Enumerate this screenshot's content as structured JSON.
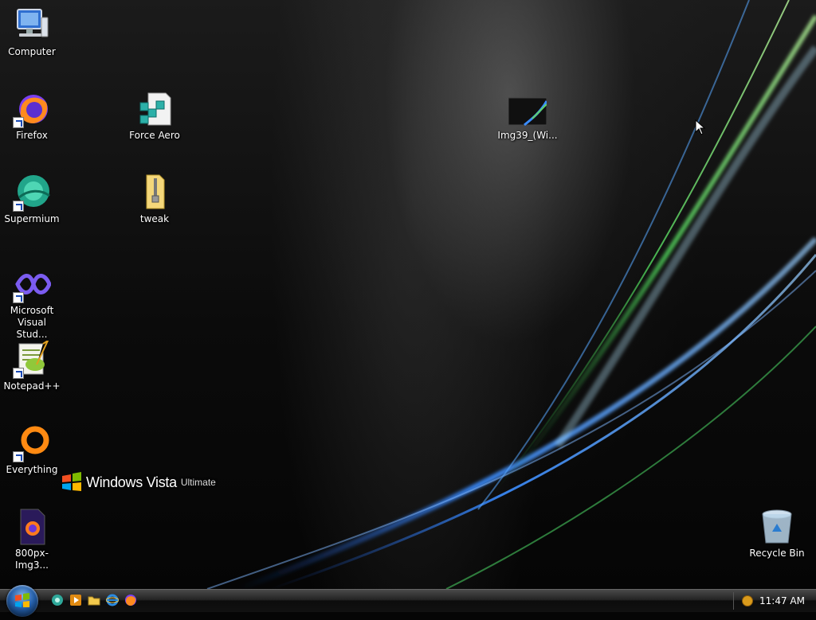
{
  "desktop": {
    "icons": [
      {
        "label": "Computer",
        "icon": "computer-icon",
        "shortcut": false
      },
      {
        "label": "Firefox",
        "icon": "firefox-icon",
        "shortcut": true
      },
      {
        "label": "Supermium",
        "icon": "supermium-icon",
        "shortcut": true
      },
      {
        "label": "Microsoft Visual Stud...",
        "icon": "visual-studio-icon",
        "shortcut": true
      },
      {
        "label": "Notepad++",
        "icon": "notepad-plus-plus-icon",
        "shortcut": true
      },
      {
        "label": "Everything",
        "icon": "everything-search-icon",
        "shortcut": true
      },
      {
        "label": "800px-Img3...",
        "icon": "image-file-icon",
        "shortcut": false
      },
      {
        "label": "Force Aero",
        "icon": "registry-file-icon",
        "shortcut": false
      },
      {
        "label": "tweak",
        "icon": "zip-folder-icon",
        "shortcut": false
      },
      {
        "label": "Img39_(Wi...",
        "icon": "wallpaper-thumbnail-icon",
        "shortcut": false
      },
      {
        "label": "Recycle Bin",
        "icon": "recycle-bin-icon",
        "shortcut": false
      }
    ],
    "branding": {
      "brand": "Windows Vista",
      "edition": "Ultimate"
    }
  },
  "taskbar": {
    "start": "start-orb-icon",
    "quick_launch": [
      "show-desktop-icon",
      "media-player-icon",
      "explorer-folder-icon",
      "internet-explorer-icon",
      "firefox-icon"
    ],
    "tray_icon": "notification-icon",
    "clock": "11:47 AM"
  },
  "colors": {
    "taskbar": "#1a1a1a",
    "accent_blue": "#2e7de0",
    "accent_green": "#5fd36a"
  }
}
